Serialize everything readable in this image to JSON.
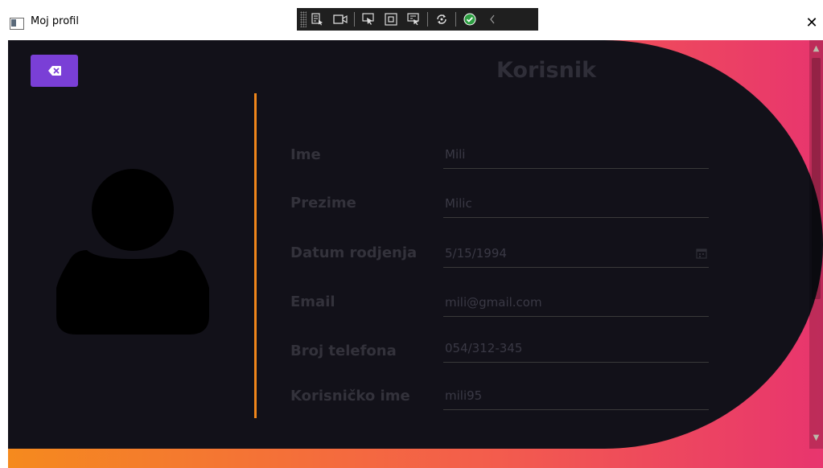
{
  "window": {
    "title": "Moj profil",
    "close_glyph": "✕"
  },
  "debug_toolbar": {
    "tools": [
      "live-visual-tree-icon",
      "record-icon",
      "select-element-icon",
      "display-layout-adorners-icon",
      "track-focus-icon",
      "hot-reload-icon",
      "status-ok-icon",
      "collapse-toolbar-icon"
    ]
  },
  "colors": {
    "accent_orange": "#f0861b",
    "button_purple": "#7a3fd6",
    "panel_dark": "#121119",
    "gradient_start": "#f58a1e",
    "gradient_end": "#e8356e"
  },
  "form": {
    "title": "Korisnik",
    "fields": [
      {
        "label": "Ime",
        "value": "Mili"
      },
      {
        "label": "Prezime",
        "value": "Milic"
      },
      {
        "label": "Datum rodjenja",
        "value": "5/15/1994"
      },
      {
        "label": "Email",
        "value": "mili@gmail.com"
      },
      {
        "label": "Broj telefona",
        "value": "054/312-345"
      },
      {
        "label": "Korisničko ime",
        "value": "mili95"
      }
    ]
  },
  "icons": {
    "back": "backspace-icon",
    "avatar": "user-avatar-icon",
    "date": "calendar-icon"
  }
}
